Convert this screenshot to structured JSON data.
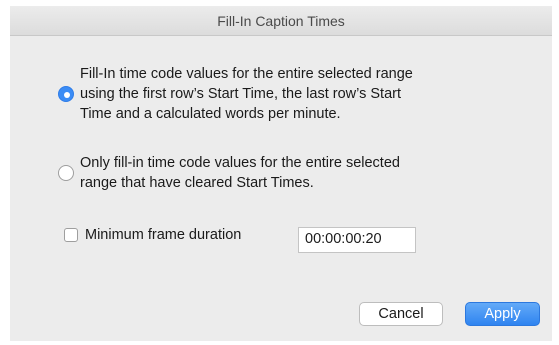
{
  "dialog": {
    "title": "Fill-In Caption Times"
  },
  "options": {
    "fill_all": {
      "line1": "Fill-In time code values for the entire selected range",
      "line2": "using the first row’s Start Time, the last row’s Start",
      "line3": "Time and a calculated words per minute.",
      "selected": true
    },
    "fill_cleared": {
      "line1": "Only fill-in time code values for the entire selected",
      "line2": "range that have cleared Start Times.",
      "selected": false
    }
  },
  "min_duration": {
    "label": "Minimum frame duration",
    "checked": false,
    "value": "00:00:00:20"
  },
  "buttons": {
    "cancel": "Cancel",
    "apply": "Apply"
  },
  "colors": {
    "accent": "#3b8cf5",
    "dialog_bg": "#ececec"
  }
}
